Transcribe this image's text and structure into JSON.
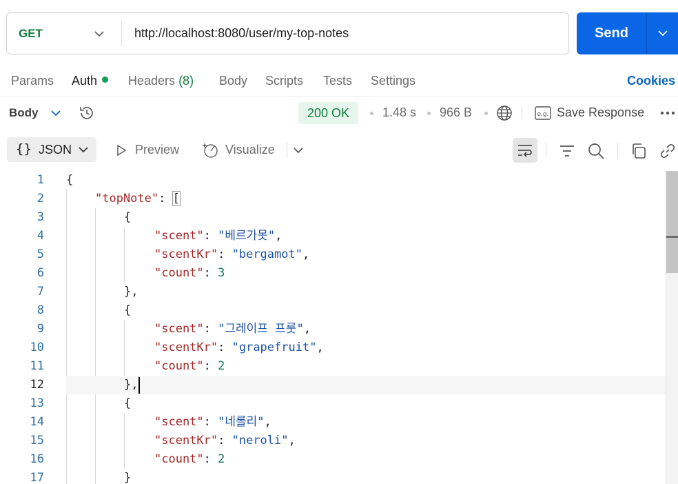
{
  "request": {
    "method": "GET",
    "url": "http://localhost:8080/user/my-top-notes",
    "send_label": "Send"
  },
  "tabs": [
    {
      "label": "Params"
    },
    {
      "label": "Auth",
      "active": true,
      "indicator": "green-dot"
    },
    {
      "label": "Headers",
      "count": "(8)"
    },
    {
      "label": "Body"
    },
    {
      "label": "Scripts"
    },
    {
      "label": "Tests"
    },
    {
      "label": "Settings"
    }
  ],
  "cookies_label": "Cookies",
  "response": {
    "section_label": "Body",
    "status": "200 OK",
    "time": "1.48 s",
    "size": "966 B",
    "save_label": "Save Response"
  },
  "toolbar": {
    "format_label": "JSON",
    "preview_label": "Preview",
    "visualize_label": "Visualize"
  },
  "editor": {
    "current_line": 12,
    "lines": [
      {
        "n": "1"
      },
      {
        "n": "2"
      },
      {
        "n": "3"
      },
      {
        "n": "4"
      },
      {
        "n": "5"
      },
      {
        "n": "6"
      },
      {
        "n": "7"
      },
      {
        "n": "8"
      },
      {
        "n": "9"
      },
      {
        "n": "10"
      },
      {
        "n": "11"
      },
      {
        "n": "12"
      },
      {
        "n": "13"
      },
      {
        "n": "14"
      },
      {
        "n": "15"
      },
      {
        "n": "16"
      },
      {
        "n": "17"
      }
    ],
    "json": {
      "open": "{",
      "top_key": "\"topNote\"",
      "open_array": "[",
      "obj_open": "{",
      "obj_close_comma": "},",
      "obj_close": "}",
      "key_scent": "\"scent\"",
      "key_scentKr": "\"scentKr\"",
      "key_count": "\"count\"",
      "items": [
        {
          "scent": "\"베르가못\"",
          "scentKr": "\"bergamot\"",
          "count": "3"
        },
        {
          "scent": "\"그레이프 프룻\"",
          "scentKr": "\"grapefruit\"",
          "count": "2"
        },
        {
          "scent": "\"네롤리\"",
          "scentKr": "\"neroli\"",
          "count": "2"
        }
      ]
    }
  },
  "colors": {
    "accent": "#0a66e4",
    "status_ok": "#0f7b3e",
    "json_key": "#a52727",
    "json_string": "#1c52a6",
    "json_number": "#0f7b5a",
    "line_number": "#2f6e9e"
  }
}
